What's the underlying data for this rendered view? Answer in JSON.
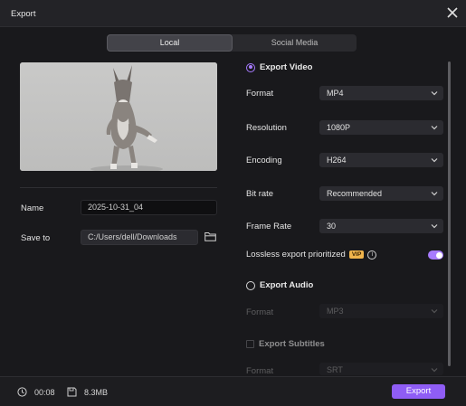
{
  "window": {
    "title": "Export"
  },
  "tabs": [
    {
      "label": "Local",
      "active": true
    },
    {
      "label": "Social Media",
      "active": false
    }
  ],
  "left": {
    "name_label": "Name",
    "name_value": "2025-10-31_04",
    "save_label": "Save to",
    "save_value": "C:/Users/dell/Downloads"
  },
  "video": {
    "section_label": "Export Video",
    "format_label": "Format",
    "format_value": "MP4",
    "resolution_label": "Resolution",
    "resolution_value": "1080P",
    "encoding_label": "Encoding",
    "encoding_value": "H264",
    "bitrate_label": "Bit rate",
    "bitrate_value": "Recommended",
    "framerate_label": "Frame Rate",
    "framerate_value": "30",
    "lossless_label": "Lossless export prioritized",
    "vip_badge": "VIP",
    "lossless_on": true
  },
  "audio": {
    "section_label": "Export Audio",
    "format_label": "Format",
    "format_value": "MP3"
  },
  "subtitles": {
    "section_label": "Export Subtitles",
    "format_label": "Format",
    "format_value": "SRT"
  },
  "footer": {
    "duration": "00:08",
    "size": "8.3MB",
    "export_label": "Export"
  },
  "colors": {
    "accent": "#a77bff",
    "button": "#8f5df5",
    "vip": "#f0b44c",
    "background": "#19191c"
  },
  "icons": [
    "close-icon",
    "folder-icon",
    "chevron-down-icon",
    "info-icon",
    "clock-icon",
    "disk-icon"
  ]
}
